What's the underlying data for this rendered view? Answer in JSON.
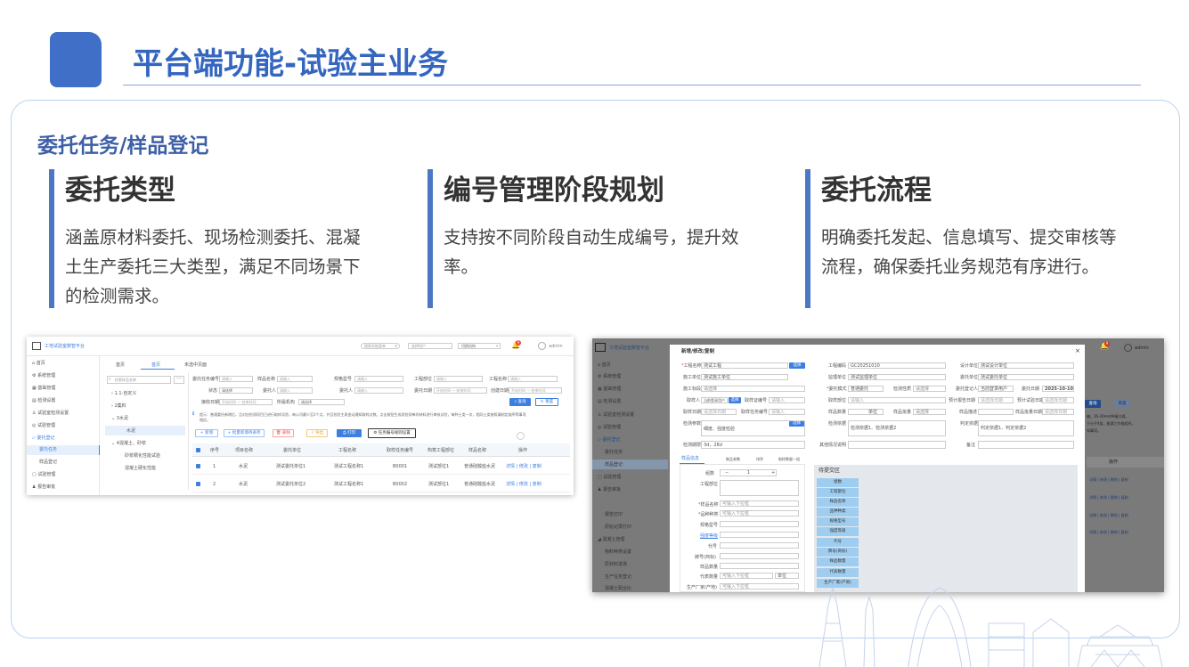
{
  "page": {
    "title": "平台端功能-试验主业务",
    "subtitle": "委托任务/样品登记"
  },
  "columns": [
    {
      "heading": "委托类型",
      "body": "涵盖原材料委托、现场检测委托、混凝土生产委托三大类型，满足不同场景下的检测需求。"
    },
    {
      "heading": "编号管理阶段规划",
      "body": "支持按不同阶段自动生成编号，提升效率。"
    },
    {
      "heading": "委托流程",
      "body": "明确委托发起、信息填写、提交审核等流程，确保委托业务规范有序进行。"
    }
  ],
  "shot1": {
    "app_name": "工地试验室数智平台",
    "header": {
      "search_placeholder": "搜索导航菜单",
      "dropdown1": "选择用户",
      "dropdown2": "切换机构",
      "badge": "9",
      "user": "admin"
    },
    "sidebar": [
      "首页",
      "系统管理",
      "基础管理",
      "检测设置",
      "试验室检测设置",
      "试验管理",
      "委托登记",
      "委托任务",
      "样品登记",
      "试验管理",
      "报告审批"
    ],
    "tabs": [
      "首页",
      "首页",
      "未选中页面"
    ],
    "tree": {
      "search_placeholder": "检索样品名称",
      "items": [
        "1.1-自定义",
        "2集料",
        "3水泥",
        "水泥",
        "4混凝土、砂浆",
        "砂浆稠化性能试验",
        "混凝土硬化性能"
      ]
    },
    "filters": {
      "row1": [
        "委托任务编号",
        "样品名称",
        "规格型号",
        "工程部位",
        "工程名称"
      ],
      "row2": [
        "状态",
        "委托人",
        "委托人"
      ],
      "row2_select": "请选择",
      "date1": "委托日期",
      "date2": "创建日期",
      "row3": [
        "接收日期",
        "所属机构"
      ],
      "placeholder": "请输入",
      "date_placeholder": "开始时间 — 结束时间",
      "query": "查询",
      "reset": "重置"
    },
    "notice": "提示：普通委托新增后，且对应检测项目已进行取样试验，每公司最少至2个点，并且检验主表变动通知取样点数。点击按钮生成发检测单的材料进行审核试验，每种土类一次，相同土类按照填制定顺序等事项相应。",
    "toolbar": {
      "add": "新增",
      "batch": "+ 批量新增待录项",
      "delete": "删除",
      "export": "导出",
      "print": "打印",
      "settings": "任务编号规则设置"
    },
    "table": {
      "headers": [
        "序号",
        "项目名称",
        "委托单位",
        "工程名称",
        "取样任务编号",
        "构筑工程部位",
        "样品名称",
        "操作"
      ],
      "rows": [
        [
          "1",
          "水泥",
          "测试委托单位1",
          "测试工程名称1",
          "B0001",
          "测试部位1",
          "普通硅酸盐水泥",
          "详情 | 修改 | 复制"
        ],
        [
          "2",
          "水泥",
          "测试委托单位2",
          "测试工程名称1",
          "B0002",
          "测试部位1",
          "普通硅酸盐水泥",
          "详情 | 修改 | 复制"
        ]
      ]
    }
  },
  "shot2": {
    "app_name": "工地试验室数智平台",
    "badge": "9",
    "user": "admin",
    "dialog_title": "新增/修改/复制",
    "sidebar": [
      "首页",
      "系统管理",
      "基础管理",
      "检测设置",
      "试验室检测设置",
      "试验管理",
      "委托登记",
      "委托任务",
      "样品登记",
      "试验管理",
      "报告审批",
      "报告打印",
      "原始记录打印",
      "混凝土管理",
      "物料种类设置",
      "原材料进场",
      "生产任务登记",
      "混凝土配合比"
    ],
    "form": {
      "r1": [
        [
          "工程名称",
          "测试工程"
        ],
        [
          "工程编码",
          "GC20251010"
        ],
        [
          "设计单位",
          "测试设计单位"
        ]
      ],
      "r1_btn": "选择",
      "r2": [
        [
          "施工单位",
          "测试施工单位"
        ],
        [
          "监理单位",
          "测试监理单位"
        ],
        [
          "委托单位",
          "测试委托单位"
        ]
      ],
      "r3": [
        [
          "施工标段",
          "请选择"
        ]
      ],
      "r4": [
        [
          "委托模式",
          "普通委托"
        ],
        [
          "检测性质",
          "请选择"
        ],
        [
          "委托登记人",
          "当前登录用户"
        ],
        [
          "委托日期",
          "2025-10-10"
        ]
      ],
      "r5": [
        [
          "取样人",
          "当前登录用户"
        ],
        [
          "取样证编号",
          "请输入"
        ],
        [
          "取样部位",
          "请输入"
        ],
        [
          "预计报告日期",
          "请选择日期"
        ],
        [
          "预计试验日期",
          "请选择日期"
        ]
      ],
      "r6": [
        [
          "取样日期",
          "请选择日期"
        ],
        [
          "取样任务编号",
          "请输入"
        ]
      ],
      "r6b": [
        [
          "样品数量",
          "单位"
        ],
        [
          "样品批量",
          "请选择"
        ],
        [
          "样品描述",
          ""
        ],
        [
          "样品批量日期",
          "请选择日期"
        ]
      ],
      "r7": [
        [
          "检测参数",
          "细度、强度检验"
        ],
        [
          "检测依据",
          "检测依据1、检测依据2"
        ],
        [
          "判定依据",
          "判定依据1、判定依据2"
        ]
      ],
      "r8": [
        [
          "检测期限",
          "3d，28d"
        ],
        [
          "其他情况说明",
          ""
        ],
        [
          "备注",
          ""
        ]
      ]
    },
    "subtabs": [
      "样品信息",
      "制品参数",
      "排序",
      "取样数量一组"
    ],
    "sample": {
      "fields": [
        "组数",
        "工程部位",
        "样品名称",
        "品种种类",
        "规格型号",
        "强度等级",
        "代号",
        "牌号(商标)",
        "样品数量",
        "代表数量",
        "生产厂家(产地)"
      ],
      "placeholder": "可输入下拉框",
      "count": "1",
      "unit": "单位"
    },
    "exchange": {
      "title": "待提交区",
      "items": [
        "组数",
        "工程部位",
        "样品名称",
        "品种种类",
        "规格型号",
        "强度等级",
        "代号",
        "牌号(商标)",
        "样品数量",
        "代表数量",
        "生产厂家(产地)"
      ]
    },
    "right": {
      "text1": "编，16-30mm种接口规，",
      "text2": "于分子4组，能满工作指组托，",
      "text3": "如事项。",
      "col": "操作",
      "op": "详情 | 修改 | 删除 | 复制",
      "query": "查询",
      "reset": "重置"
    }
  },
  "colors": {
    "accent": "#3f6fc7",
    "title": "#3466c0",
    "panel_border": "#b8d2ef",
    "bar": "#4b78c4"
  }
}
